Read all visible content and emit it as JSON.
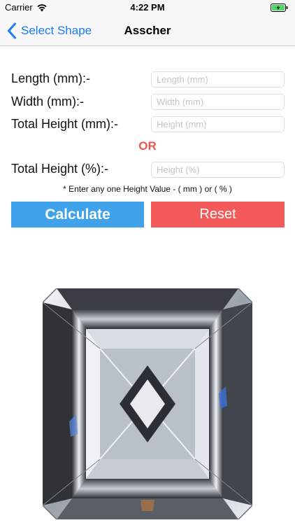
{
  "status_bar": {
    "carrier": "Carrier",
    "time": "4:22 PM",
    "wifi_icon": "wifi-icon",
    "battery_icon": "battery-charging-icon"
  },
  "nav": {
    "back_label": "Select Shape",
    "back_icon": "chevron-left-icon",
    "title": "Asscher",
    "tint_color": "#1b7cf3"
  },
  "form": {
    "length_label": "Length (mm):-",
    "length_placeholder": "Length (mm)",
    "width_label": "Width (mm):-",
    "width_placeholder": "Width (mm)",
    "total_height_mm_label": "Total Height (mm):-",
    "total_height_mm_placeholder": "Height (mm)",
    "or_text": "OR",
    "total_height_pct_label": "Total Height (%):-",
    "total_height_pct_placeholder": "Height (%)",
    "note": "* Enter any one Height Value - ( mm ) or ( % )"
  },
  "buttons": {
    "calculate_label": "Calculate",
    "reset_label": "Reset",
    "calculate_color": "#3fa2ea",
    "reset_color": "#f45a5a"
  },
  "image": {
    "shape": "asscher-cut-diamond"
  }
}
